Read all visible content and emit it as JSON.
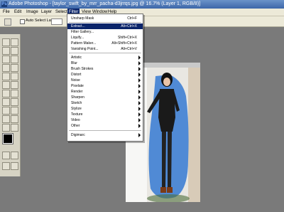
{
  "app": {
    "title_text": "Adobe Photoshop - [taylor_swift_by_mrr_pacha-d3jrrqs.jpg @ 16.7% (Layer 1, RGB/8)]"
  },
  "menubar": {
    "items": [
      {
        "label": "File"
      },
      {
        "label": "Edit"
      },
      {
        "label": "Image"
      },
      {
        "label": "Layer"
      },
      {
        "label": "Select"
      },
      {
        "label": "Filter"
      },
      {
        "label": "View"
      },
      {
        "label": "Window"
      },
      {
        "label": "Help"
      }
    ],
    "active": "Filter"
  },
  "options": {
    "auto_select_label": "Auto Select Layer"
  },
  "filter_menu": {
    "items": [
      {
        "label": "Unsharp Mask",
        "shortcut": "Ctrl+F"
      },
      {
        "label": "Extract...",
        "shortcut": "Alt+Ctrl+X",
        "selected": true
      },
      {
        "label": "Filter Gallery...",
        "shortcut": ""
      },
      {
        "label": "Liquify...",
        "shortcut": "Shift+Ctrl+X"
      },
      {
        "label": "Pattern Maker...",
        "shortcut": "Alt+Shift+Ctrl+X"
      },
      {
        "label": "Vanishing Point...",
        "shortcut": "Alt+Ctrl+V"
      },
      {
        "label": "Artistic",
        "submenu": true
      },
      {
        "label": "Blur",
        "submenu": true
      },
      {
        "label": "Brush Strokes",
        "submenu": true
      },
      {
        "label": "Distort",
        "submenu": true
      },
      {
        "label": "Noise",
        "submenu": true
      },
      {
        "label": "Pixelate",
        "submenu": true
      },
      {
        "label": "Render",
        "submenu": true
      },
      {
        "label": "Sharpen",
        "submenu": true
      },
      {
        "label": "Sketch",
        "submenu": true
      },
      {
        "label": "Stylize",
        "submenu": true
      },
      {
        "label": "Texture",
        "submenu": true
      },
      {
        "label": "Video",
        "submenu": true
      },
      {
        "label": "Other",
        "submenu": true
      },
      {
        "label": "Digimarc",
        "submenu": true
      }
    ]
  },
  "colors": {
    "highlight": "#0a246a",
    "extract_fill": "#3f7fd4"
  }
}
